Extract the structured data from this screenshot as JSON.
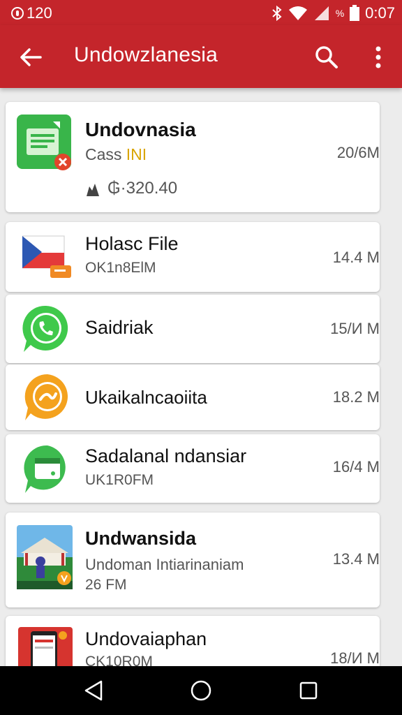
{
  "status_bar": {
    "left_text": "120",
    "battery_label": "%",
    "time": "0:07"
  },
  "app_bar": {
    "title": "Undowzlanesia",
    "back_icon": "arrow-back-icon",
    "search_icon": "search-icon",
    "more_icon": "more-vert-icon"
  },
  "items": [
    {
      "name": "Undovnasia",
      "subtitle": "Cass",
      "subtitle_badge": "INI",
      "extra": "₲·320.40",
      "size": "20/6M",
      "icon": "green-document-icon"
    },
    {
      "name": "Holasc File",
      "subtitle": "OK1n8ElM",
      "size": "14.4 M",
      "icon": "flag-folder-icon"
    },
    {
      "name": "Saidriak",
      "subtitle": "",
      "size": "15/И M",
      "icon": "whatsapp-icon"
    },
    {
      "name": "Ukaikalncaoiita",
      "subtitle": "",
      "size": "18.2 M",
      "icon": "orange-chat-icon"
    },
    {
      "name": "Sadalanal ndansiar",
      "subtitle": "UK1R0FM",
      "size": "16/4 M",
      "icon": "green-chat-card-icon"
    },
    {
      "name": "Undwansida",
      "subtitle": "Undoman Intiarinaniam",
      "extra": "26 FM",
      "size": "13.4 M",
      "icon": "game-thumbnail-icon"
    },
    {
      "name": "Undovaiaphan",
      "subtitle": "CK10R0M",
      "size": "18/И M",
      "icon": "phone-app-icon"
    }
  ],
  "nav_bar": {
    "back_icon": "nav-back-icon",
    "home_icon": "nav-home-icon",
    "recents_icon": "nav-recents-icon"
  }
}
